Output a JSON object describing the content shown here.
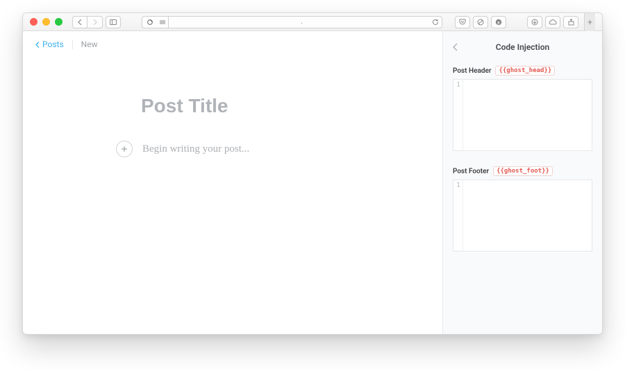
{
  "browser": {
    "address": "."
  },
  "breadcrumb": {
    "back_label": "Posts",
    "current": "New"
  },
  "editor": {
    "title_placeholder": "Post Title",
    "title_value": "",
    "body_placeholder": "Begin writing your post..."
  },
  "sidebar": {
    "title": "Code Injection",
    "header_section": {
      "label": "Post Header",
      "tag": "{{ghost_head}}",
      "line_number": "1",
      "value": ""
    },
    "footer_section": {
      "label": "Post Footer",
      "tag": "{{ghost_foot}}",
      "line_number": "1",
      "value": ""
    }
  }
}
